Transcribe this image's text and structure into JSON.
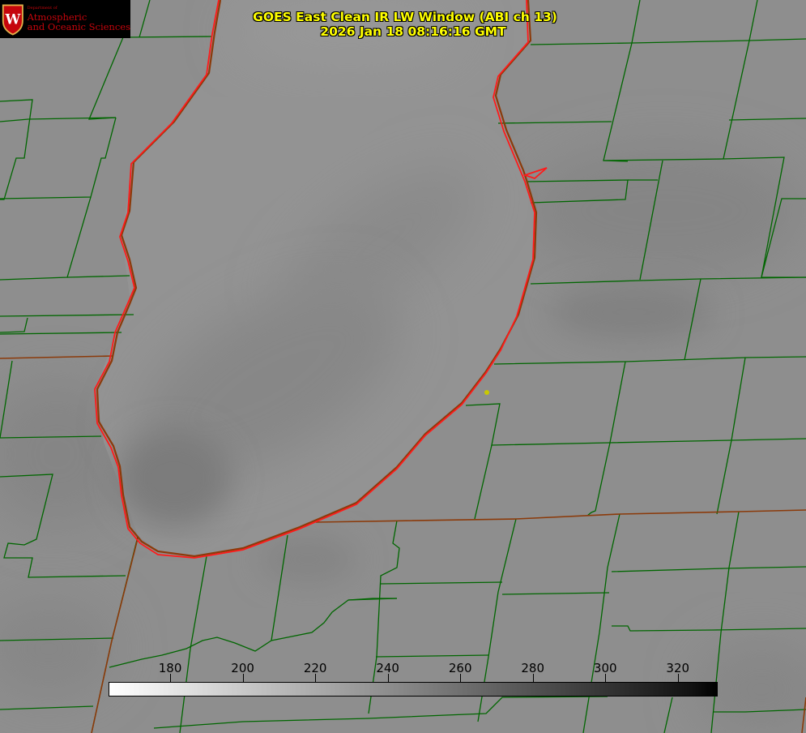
{
  "image": {
    "title_line1": "GOES East Clean IR LW Window (ABI ch 13)",
    "title_line2": "2026 Jan 18 08:16:16 GMT",
    "logo": {
      "dept": "Department of",
      "line1": "Atmospheric",
      "line2": "and Oceanic Sciences",
      "crest_letter": "W"
    }
  },
  "colorbar": {
    "min": 163,
    "max": 331,
    "labels": [
      "180",
      "200",
      "220",
      "240",
      "260",
      "280",
      "300",
      "320"
    ],
    "ticks": [
      180,
      200,
      220,
      240,
      260,
      280,
      300,
      320
    ],
    "colors": {
      "start": "#ffffff",
      "end": "#000000"
    }
  },
  "colors": {
    "background": "#8d8d8d",
    "county_lines": "#006600",
    "state_lines": "#8b3a0a",
    "coastline": "#ff0000",
    "title_text": "#ffff00",
    "marker": "#c9c900"
  }
}
